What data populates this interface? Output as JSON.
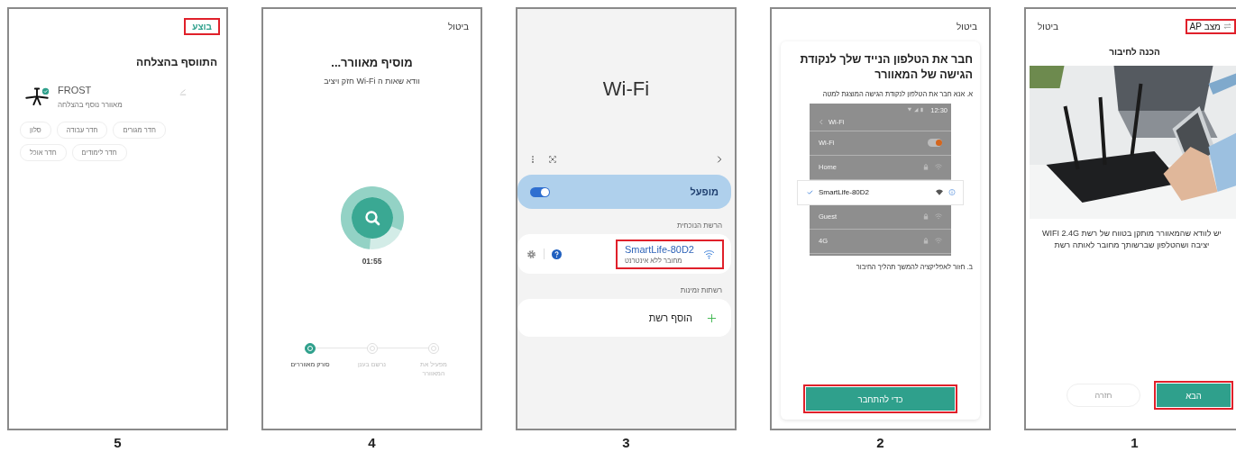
{
  "screens": [
    {
      "kind": "prepare",
      "number": "1",
      "mode": {
        "label": "מצב AP",
        "highlighted": true
      },
      "cancel": "ביטול",
      "title": "הכנה לחיבור",
      "image": {
        "kind": "picture"
      },
      "text": "יש לוודא שהמאוורר מותקן בטווח של רשת WIFI 2.4G יציבה ושהטלפון שברשותך מחובר לאותה רשת",
      "buttons": [
        {
          "label": "הבא",
          "kind": "primary",
          "disabled": false,
          "highlighted": true
        },
        {
          "label": "חזרה",
          "kind": "secondary",
          "disabled": true,
          "highlighted": false
        }
      ]
    },
    {
      "kind": "connect",
      "number": "2",
      "cancel": "ביטול",
      "title": "חבר את הטלפון הנייד שלך לנקודת הגישה של המאוורר",
      "step_a": "א. אנא חבר את הטלפון לנקודת הגישה המוצגת למטה",
      "mockup": {
        "time": "12:30",
        "header": "Wi-Fi",
        "rows": [
          {
            "kind": "toggle",
            "label": "Wi-Fi",
            "on": true
          },
          {
            "kind": "network",
            "label": "Home",
            "selected": false
          },
          {
            "kind": "network",
            "label": "SmartLife-80D2",
            "selected": true
          },
          {
            "kind": "network",
            "label": "Guest",
            "selected": false
          },
          {
            "kind": "network",
            "label": "4G",
            "selected": false
          }
        ]
      },
      "step_b": "ב. חזור לאפליקציה להמשך תהליך החיבור",
      "button": {
        "label": "כדי להתחבר",
        "highlighted": true
      }
    },
    {
      "kind": "wifi",
      "number": "3",
      "title": "Wi‑Fi",
      "wifi_toggle": {
        "label": "מופעל",
        "on": true
      },
      "current_heading": "הרשת הנוכחית",
      "network": {
        "name": "SmartLife-80D2",
        "status": "מחובר ללא אינטרנט",
        "highlighted": true
      },
      "available_heading": "רשתות זמינות",
      "add_network": "הוסף רשת"
    },
    {
      "kind": "adding",
      "number": "4",
      "cancel": "ביטול",
      "title": "מוסיף מאוורר...",
      "subtitle": "וודא שאות ה Wi-Fi חזק ויציב",
      "progress": {
        "level": 0.8
      },
      "timer": "01:55",
      "steps": [
        {
          "label": "מפעיל את המאוורר",
          "selected": false
        },
        {
          "label": "נרשם בענן",
          "selected": false
        },
        {
          "label": "סורק מאווררים",
          "selected": true
        }
      ]
    },
    {
      "kind": "added",
      "number": "5",
      "done": {
        "label": "בוצע",
        "highlighted": true
      },
      "title": "התווסף בהצלחה",
      "device": {
        "name": "FROST",
        "status": "מאוורר נוסף בהצלחה"
      },
      "room_rows": [
        [
          "חדר מגורים",
          "חדר עבודה",
          "סלון"
        ],
        [
          "חדר לימודים",
          "חדר אוכל"
        ]
      ]
    }
  ]
}
